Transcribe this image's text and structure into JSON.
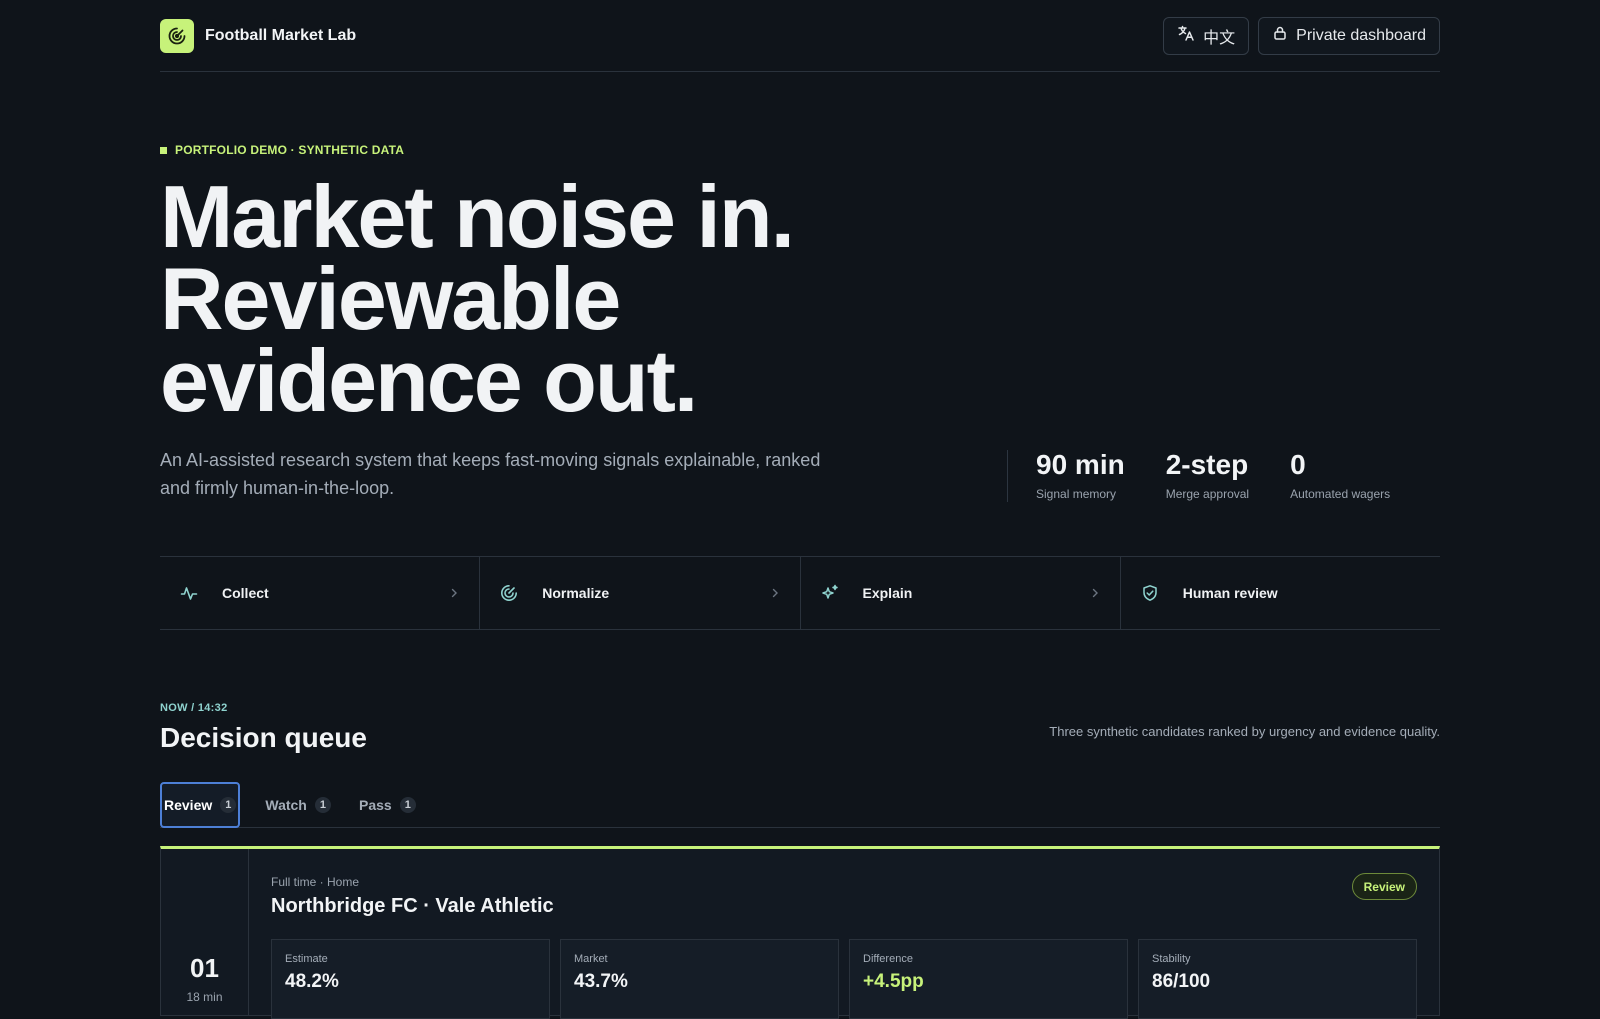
{
  "header": {
    "brand_name": "Football Market Lab",
    "language_label": "中文",
    "private_label": "Private dashboard"
  },
  "hero": {
    "eyebrow": "PORTFOLIO DEMO · SYNTHETIC DATA",
    "headline_lines": [
      "Market noise in.",
      "Reviewable",
      "evidence out."
    ],
    "lede": "An AI-assisted research system that keeps fast-moving signals explainable, ranked and firmly human-in-the-loop.",
    "stats": [
      {
        "value": "90 min",
        "label": "Signal memory"
      },
      {
        "value": "2-step",
        "label": "Merge approval"
      },
      {
        "value": "0",
        "label": "Automated wagers"
      }
    ]
  },
  "pipeline": [
    {
      "label": "Collect",
      "icon": "activity-icon"
    },
    {
      "label": "Normalize",
      "icon": "radar-icon"
    },
    {
      "label": "Explain",
      "icon": "sparkles-icon"
    },
    {
      "label": "Human review",
      "icon": "shield-check-icon"
    }
  ],
  "queue": {
    "eyebrow": "NOW / 14:32",
    "title": "Decision queue",
    "description": "Three synthetic candidates ranked by urgency and evidence quality.",
    "tabs": [
      {
        "label": "Review",
        "count": "1",
        "active": true
      },
      {
        "label": "Watch",
        "count": "1",
        "active": false
      },
      {
        "label": "Pass",
        "count": "1",
        "active": false
      }
    ],
    "card": {
      "rank": "01",
      "time": "18 min",
      "meta": "Full time · Home",
      "title": "Northbridge FC · Vale Athletic",
      "badge": "Review",
      "metrics": [
        {
          "label": "Estimate",
          "value": "48.2%"
        },
        {
          "label": "Market",
          "value": "43.7%"
        },
        {
          "label": "Difference",
          "value": "+4.5pp"
        },
        {
          "label": "Stability",
          "value": "86/100"
        }
      ]
    }
  },
  "colors": {
    "background": "#0f141a",
    "accent": "#c7f27a",
    "teal": "#8fd3cf",
    "focus": "#4d7fd6"
  }
}
